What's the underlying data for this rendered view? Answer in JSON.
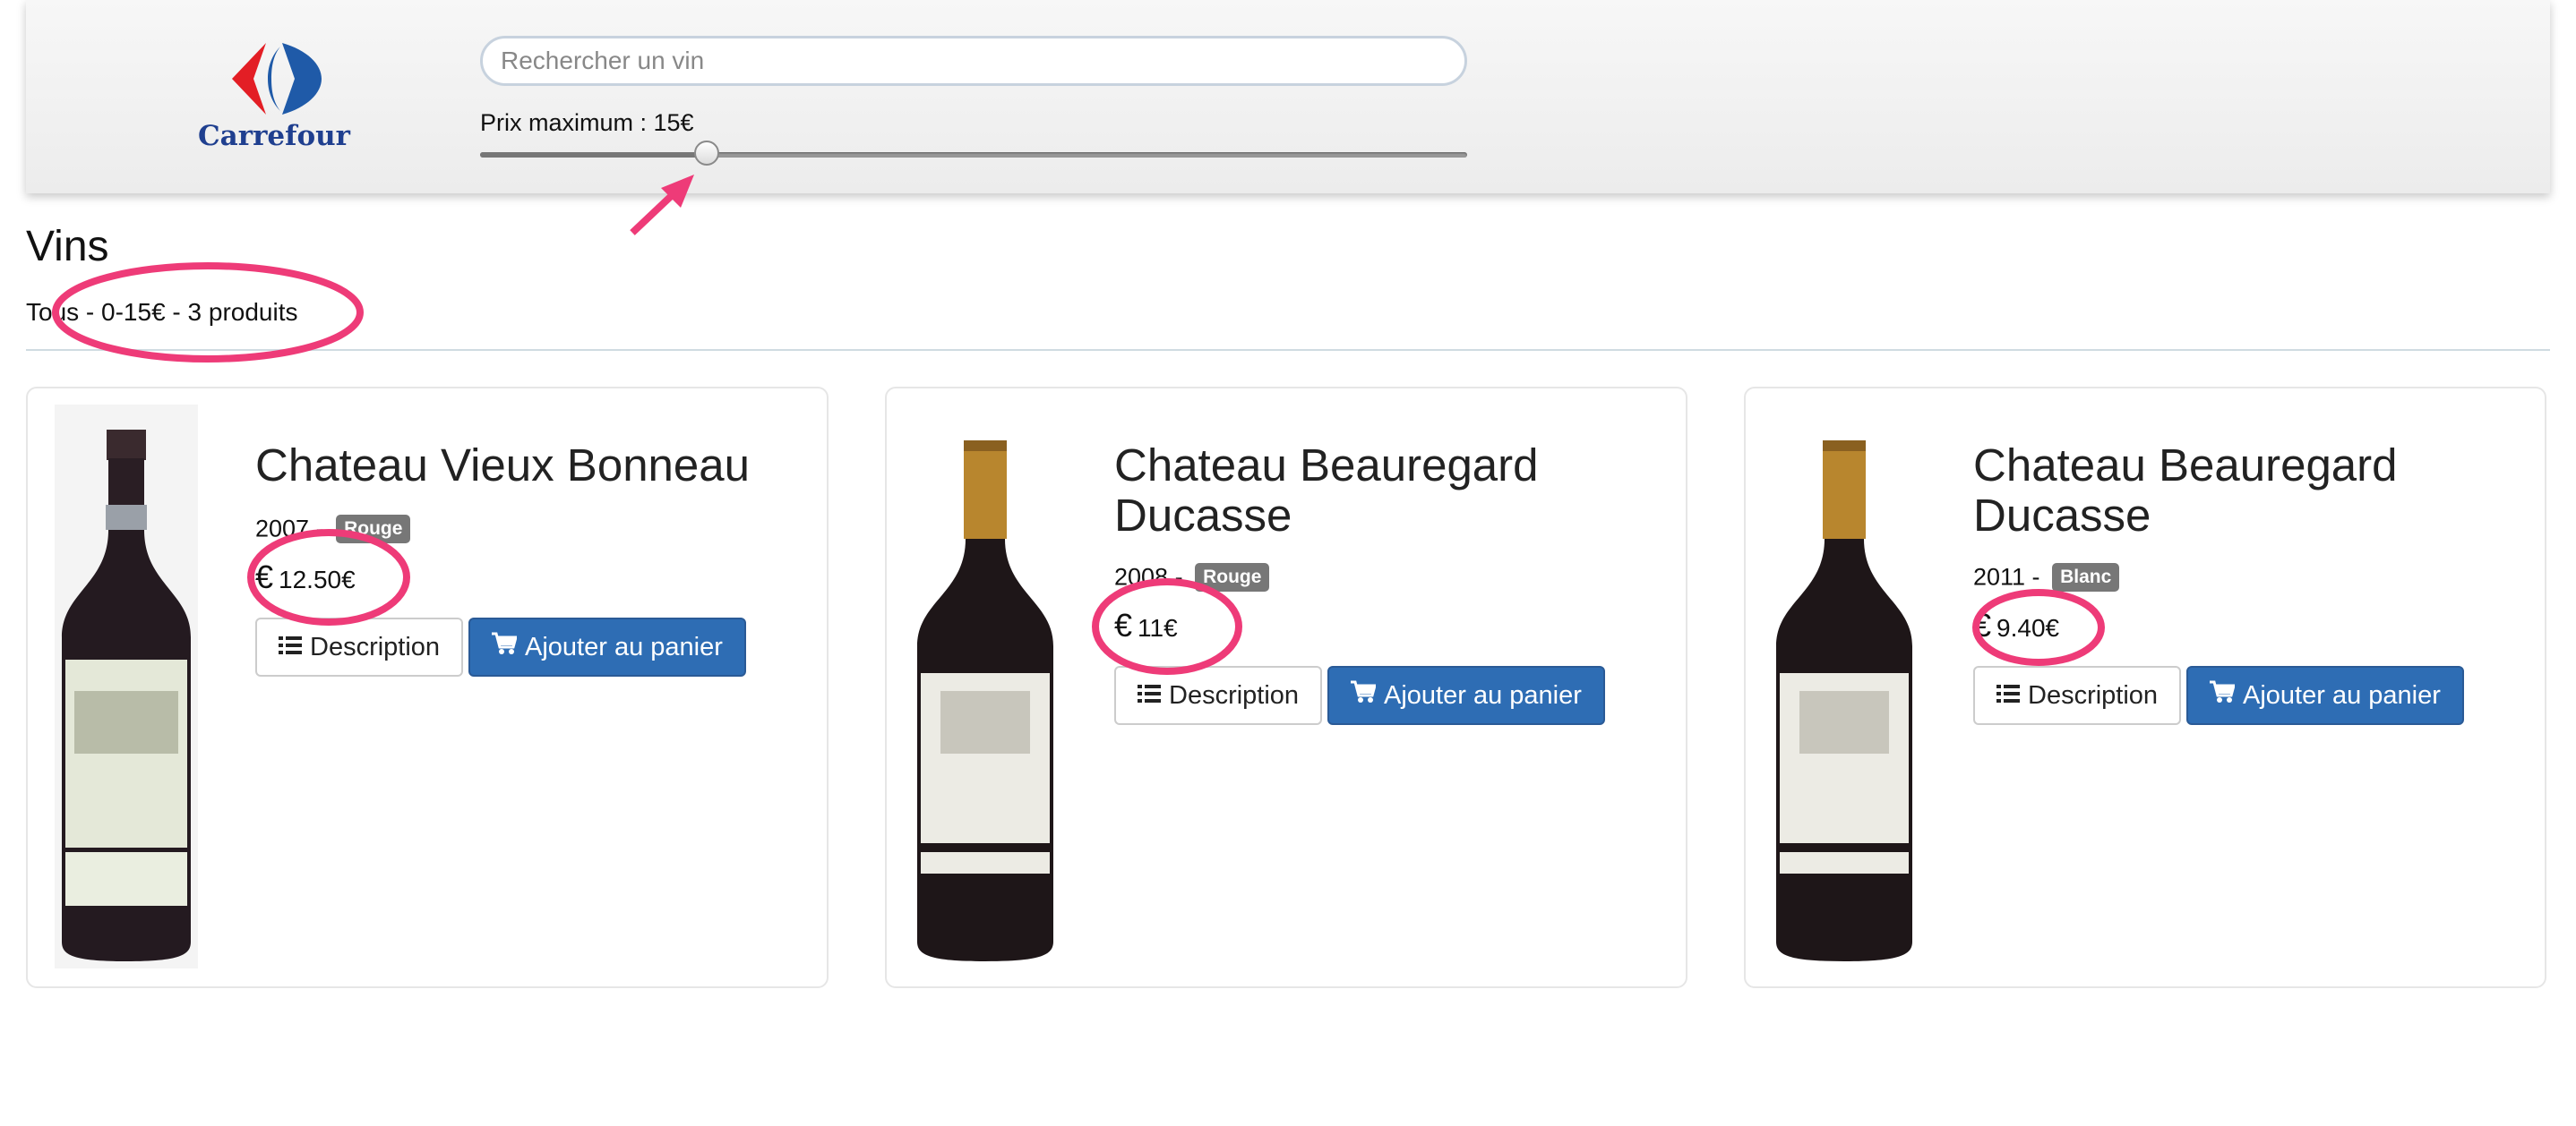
{
  "header": {
    "brand_name": "Carrefour",
    "logo_icon": "carrefour-logo-icon",
    "search_placeholder": "Rechercher un vin",
    "search_value": "",
    "price_filter_label": "Prix maximum : 15€",
    "price_slider_value_fraction": 0.23
  },
  "section": {
    "title": "Vins",
    "summary": "Tous - 0-15€ - 3 produits"
  },
  "products": [
    {
      "name": "Chateau Vieux Bonneau",
      "year_prefix": "2007 -",
      "color_badge": "Rouge",
      "price": "12.50€",
      "price_icon": "euro-icon",
      "description_label": "Description",
      "add_to_cart_label": "Ajouter au panier"
    },
    {
      "name": "Chateau Beauregard Ducasse",
      "year_prefix": "2008 -",
      "color_badge": "Rouge",
      "price": "11€",
      "price_icon": "euro-icon",
      "description_label": "Description",
      "add_to_cart_label": "Ajouter au panier"
    },
    {
      "name": "Chateau Beauregard Ducasse",
      "year_prefix": "2011 -",
      "color_badge": "Blanc",
      "price": "9.40€",
      "price_icon": "euro-icon",
      "description_label": "Description",
      "add_to_cart_label": "Ajouter au panier"
    }
  ],
  "colors": {
    "primary_button": "#2e6db4",
    "badge": "#777777",
    "annotation": "#ee3b78",
    "brand_blue": "#1f3f8f",
    "brand_red": "#e31e25"
  }
}
